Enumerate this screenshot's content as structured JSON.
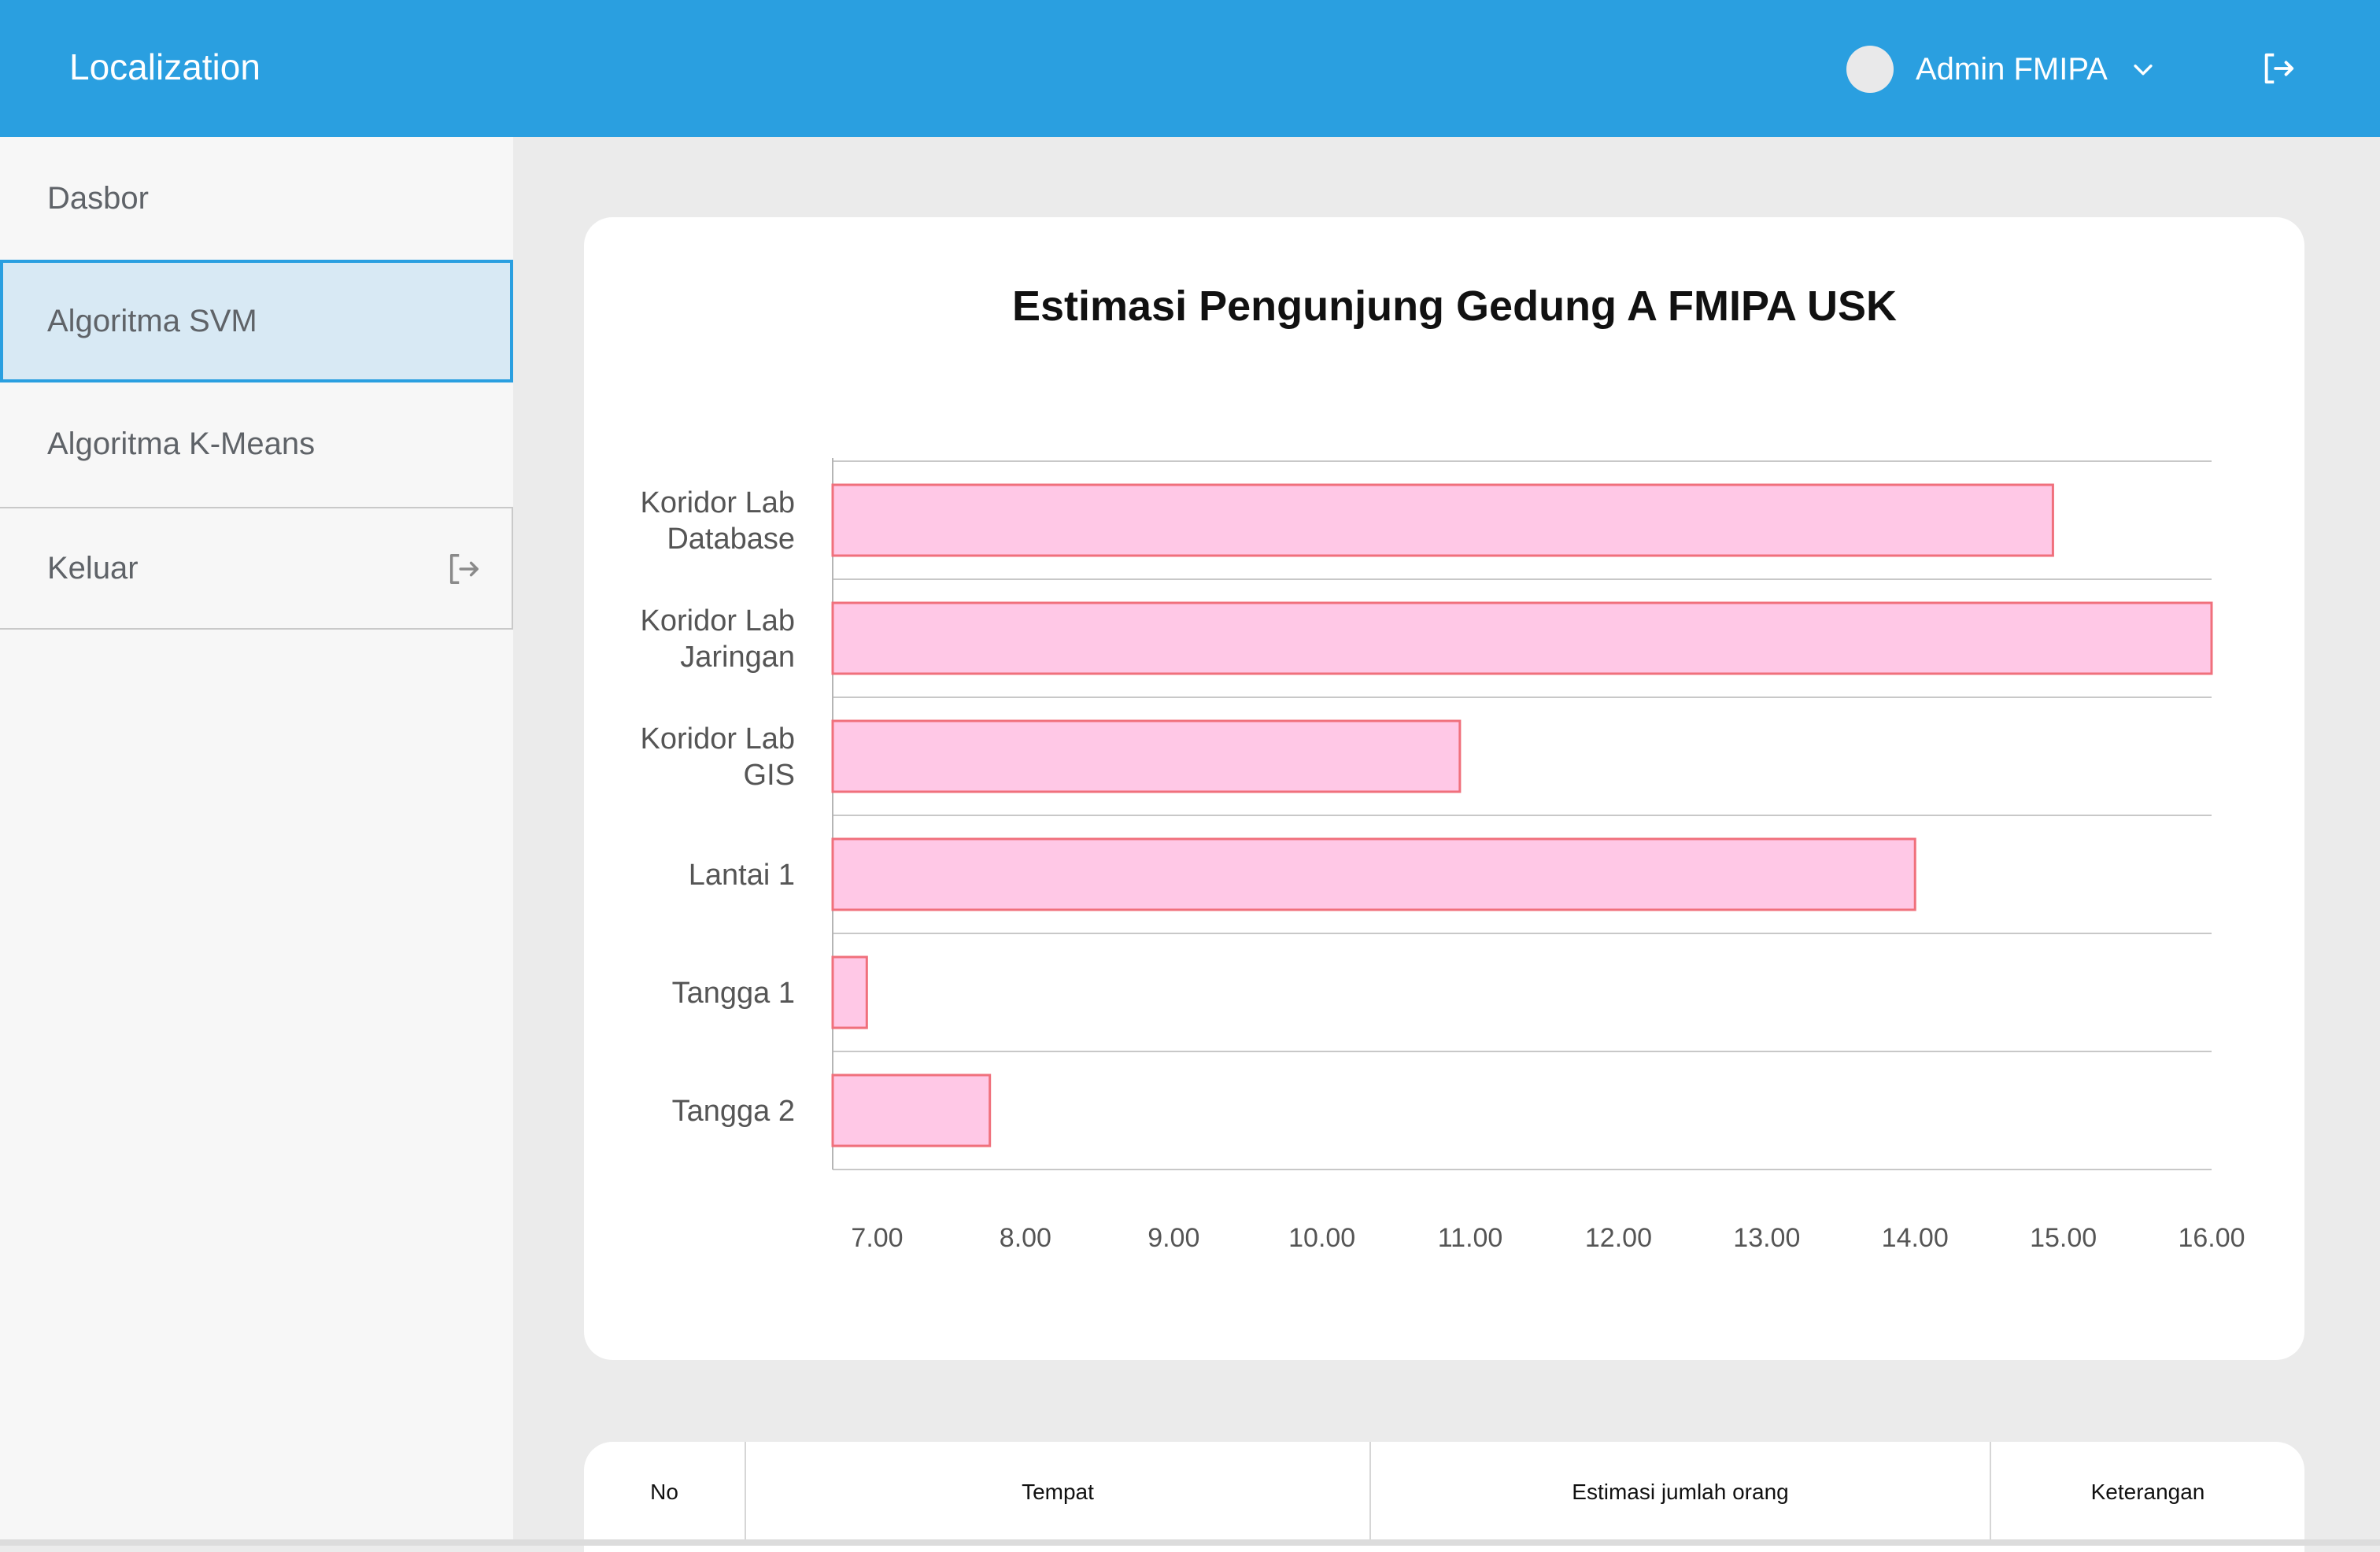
{
  "app": {
    "title": "Localization"
  },
  "header": {
    "user_name": "Admin FMIPA",
    "icons": {
      "avatar": "avatar-circle",
      "dropdown": "chevron-down-icon",
      "logout": "logout-icon"
    }
  },
  "sidebar": {
    "items": [
      {
        "label": "Dasbor",
        "active": false
      },
      {
        "label": "Algoritma SVM",
        "active": true
      },
      {
        "label": "Algoritma K-Means",
        "active": false
      },
      {
        "label": "Keluar",
        "active": false,
        "icon": "logout-icon"
      }
    ]
  },
  "colors": {
    "header_bg": "#2a9fe0",
    "active_item_bg": "#d8e9f4",
    "bar_fill": "#ffc8e6",
    "bar_stroke": "#f0707c"
  },
  "chart_data": {
    "type": "bar",
    "orientation": "horizontal",
    "title": "Estimasi Pengunjung Gedung A FMIPA USK",
    "categories": [
      [
        "Koridor Lab",
        "Database"
      ],
      [
        "Koridor Lab",
        "Jaringan"
      ],
      [
        "Koridor Lab",
        "GIS"
      ],
      [
        "Lantai 1"
      ],
      [
        "Tangga 1"
      ],
      [
        "Tangga 2"
      ]
    ],
    "values": [
      14.93,
      16.0,
      10.93,
      14.0,
      6.93,
      7.76
    ],
    "x_ticks": [
      "7.00",
      "8.00",
      "9.00",
      "10.00",
      "11.00",
      "12.00",
      "13.00",
      "14.00",
      "15.00",
      "16.00"
    ],
    "xlim": [
      6.7,
      16.0
    ],
    "grid": true
  },
  "table": {
    "headers": [
      "No",
      "Tempat",
      "Estimasi jumlah orang",
      "Keterangan"
    ]
  }
}
